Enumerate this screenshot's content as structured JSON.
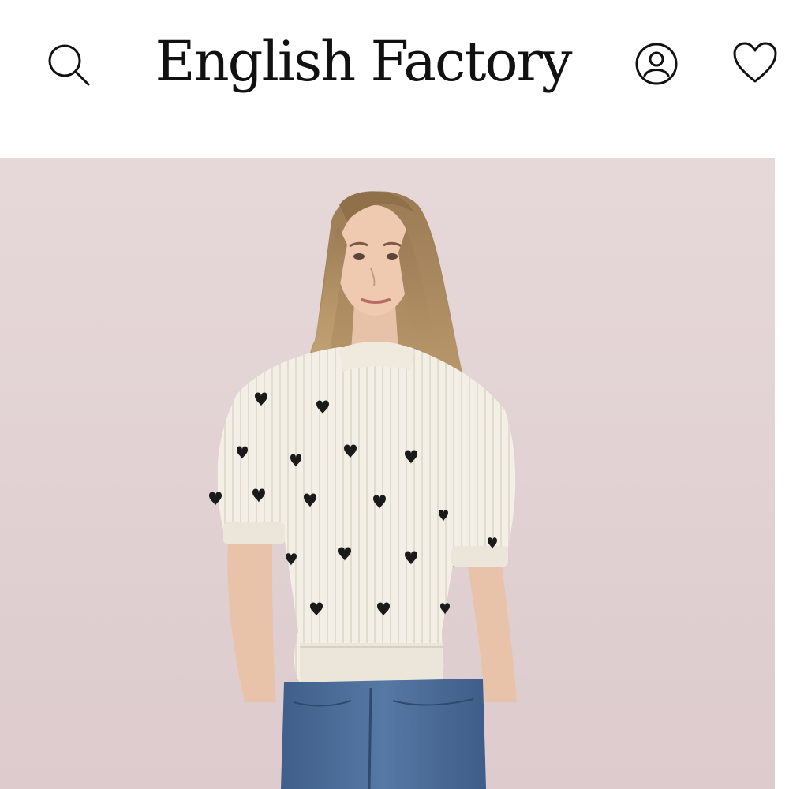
{
  "header": {
    "brand_name": "English Factory",
    "icons": {
      "search": "search-icon",
      "account": "user-account-icon",
      "wishlist": "heart-icon"
    }
  },
  "hero": {
    "image": "product-photo",
    "background_color": "#e3d5d6"
  }
}
